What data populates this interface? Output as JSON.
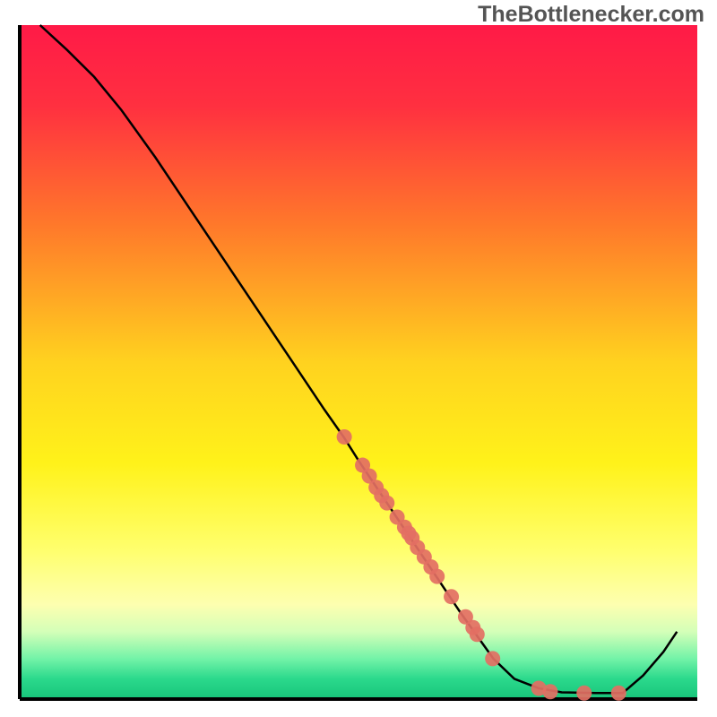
{
  "watermark": "TheBottlenecker.com",
  "chart_data": {
    "type": "line",
    "title": "",
    "xlabel": "",
    "ylabel": "",
    "xlim": [
      0,
      100
    ],
    "ylim": [
      0,
      100
    ],
    "gradient_stops": [
      {
        "offset": 0.0,
        "color": "#ff1a47"
      },
      {
        "offset": 0.12,
        "color": "#ff3040"
      },
      {
        "offset": 0.3,
        "color": "#ff7a2a"
      },
      {
        "offset": 0.5,
        "color": "#ffd21f"
      },
      {
        "offset": 0.65,
        "color": "#fff21a"
      },
      {
        "offset": 0.78,
        "color": "#ffff6e"
      },
      {
        "offset": 0.86,
        "color": "#fdffb0"
      },
      {
        "offset": 0.9,
        "color": "#d4ffb8"
      },
      {
        "offset": 0.94,
        "color": "#73f3a8"
      },
      {
        "offset": 0.97,
        "color": "#2bd98c"
      },
      {
        "offset": 1.0,
        "color": "#17c47a"
      }
    ],
    "curve": [
      {
        "x": 3.0,
        "y": 100.0
      },
      {
        "x": 7.0,
        "y": 96.3
      },
      {
        "x": 11.0,
        "y": 92.3
      },
      {
        "x": 15.0,
        "y": 87.4
      },
      {
        "x": 20.0,
        "y": 80.4
      },
      {
        "x": 25.0,
        "y": 72.9
      },
      {
        "x": 30.0,
        "y": 65.4
      },
      {
        "x": 35.0,
        "y": 57.9
      },
      {
        "x": 40.0,
        "y": 50.4
      },
      {
        "x": 45.0,
        "y": 42.9
      },
      {
        "x": 47.8,
        "y": 38.9
      },
      {
        "x": 50.0,
        "y": 35.4
      },
      {
        "x": 55.0,
        "y": 27.9
      },
      {
        "x": 60.0,
        "y": 20.4
      },
      {
        "x": 65.0,
        "y": 12.9
      },
      {
        "x": 69.9,
        "y": 6.0
      },
      {
        "x": 73.0,
        "y": 3.0
      },
      {
        "x": 76.6,
        "y": 1.6
      },
      {
        "x": 80.0,
        "y": 1.0
      },
      {
        "x": 85.0,
        "y": 0.9
      },
      {
        "x": 89.0,
        "y": 0.9
      },
      {
        "x": 92.0,
        "y": 3.5
      },
      {
        "x": 95.0,
        "y": 7.0
      },
      {
        "x": 97.0,
        "y": 10.0
      }
    ],
    "points": [
      {
        "x": 47.9,
        "y": 38.9
      },
      {
        "x": 50.6,
        "y": 34.7
      },
      {
        "x": 51.6,
        "y": 33.1
      },
      {
        "x": 52.6,
        "y": 31.4
      },
      {
        "x": 53.4,
        "y": 30.2
      },
      {
        "x": 54.2,
        "y": 29.1
      },
      {
        "x": 55.7,
        "y": 27.0
      },
      {
        "x": 56.8,
        "y": 25.5
      },
      {
        "x": 57.4,
        "y": 24.6
      },
      {
        "x": 57.9,
        "y": 23.9
      },
      {
        "x": 58.7,
        "y": 22.5
      },
      {
        "x": 59.7,
        "y": 21.1
      },
      {
        "x": 60.7,
        "y": 19.6
      },
      {
        "x": 61.6,
        "y": 18.2
      },
      {
        "x": 63.7,
        "y": 15.2
      },
      {
        "x": 65.8,
        "y": 12.2
      },
      {
        "x": 66.9,
        "y": 10.6
      },
      {
        "x": 67.5,
        "y": 9.6
      },
      {
        "x": 69.8,
        "y": 6.0
      },
      {
        "x": 76.6,
        "y": 1.6
      },
      {
        "x": 78.3,
        "y": 1.1
      },
      {
        "x": 83.3,
        "y": 0.9
      },
      {
        "x": 88.4,
        "y": 0.9
      }
    ],
    "point_color": "#e36f63",
    "curve_color": "#000000"
  }
}
